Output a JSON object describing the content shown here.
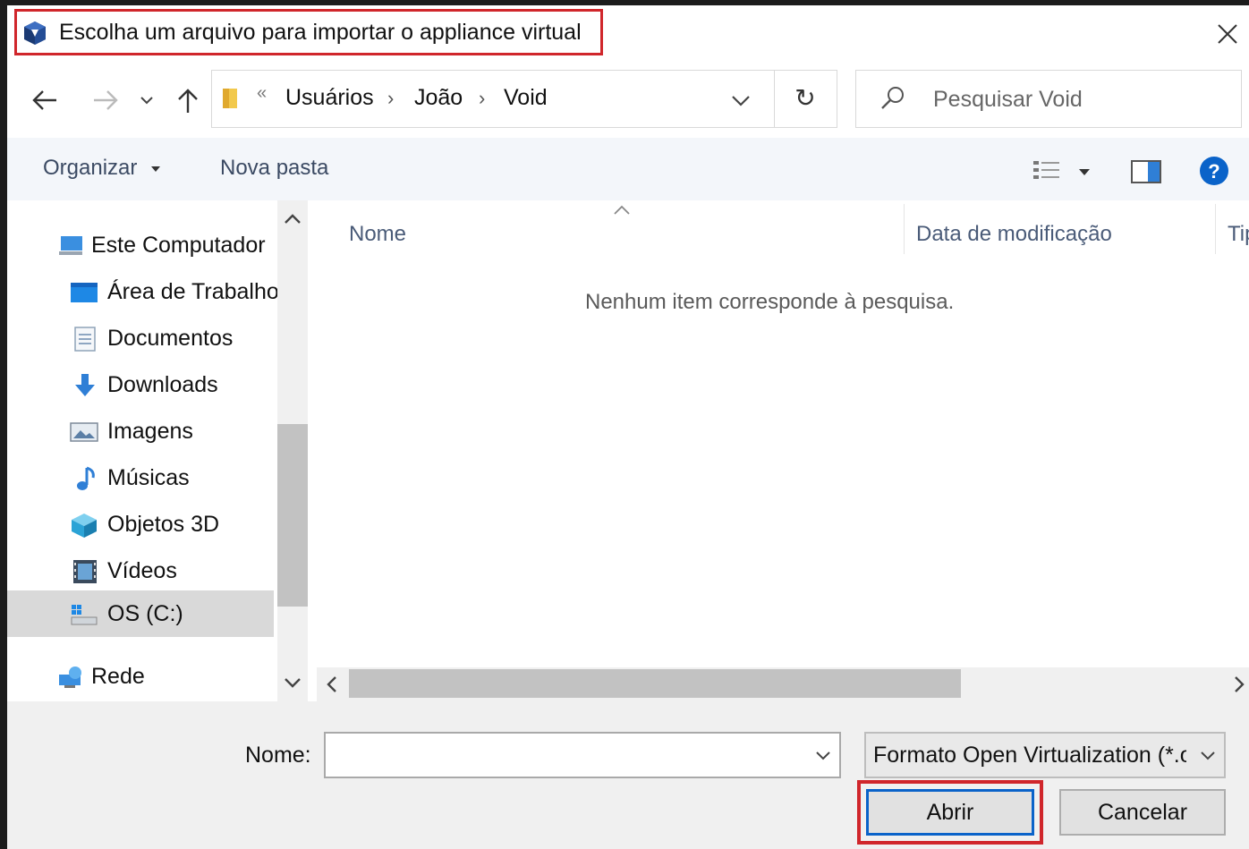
{
  "window": {
    "title": "Escolha um arquivo para importar o appliance virtual",
    "close_glyph": "✕"
  },
  "nav": {
    "back_glyph": "←",
    "forward_glyph": "→",
    "recent_glyph": "⌄",
    "up_glyph": "↑",
    "overflow_glyph": "«",
    "breadcrumb": [
      "Usuários",
      "João",
      "Void"
    ],
    "refresh_glyph": "↻",
    "search_placeholder": "Pesquisar Void"
  },
  "toolbar": {
    "organize": "Organizar",
    "new_folder": "Nova pasta",
    "help_glyph": "?"
  },
  "sidebar": {
    "items": [
      {
        "label": "Este Computador",
        "icon": "computer-icon"
      },
      {
        "label": "Área de Trabalho",
        "icon": "desktop-icon"
      },
      {
        "label": "Documentos",
        "icon": "documents-icon"
      },
      {
        "label": "Downloads",
        "icon": "download-icon"
      },
      {
        "label": "Imagens",
        "icon": "pictures-icon"
      },
      {
        "label": "Músicas",
        "icon": "music-icon"
      },
      {
        "label": "Objetos 3D",
        "icon": "3d-objects-icon"
      },
      {
        "label": "Vídeos",
        "icon": "videos-icon"
      },
      {
        "label": "OS (C:)",
        "icon": "drive-icon",
        "selected": true
      },
      {
        "label": "Rede",
        "icon": "network-icon"
      }
    ]
  },
  "filelist": {
    "columns": [
      "Nome",
      "Data de modificação",
      "Tipo"
    ],
    "empty_message": "Nenhum item corresponde à pesquisa."
  },
  "footer": {
    "name_label": "Nome:",
    "name_value": "",
    "filter_value": "Formato Open Virtualization (*.ova;*.ovf)",
    "open_button": "Abrir",
    "cancel_button": "Cancelar"
  },
  "colors": {
    "highlight": "#d0262b",
    "accent": "#0a63c9",
    "toolbar_bg": "#f3f6fa"
  }
}
